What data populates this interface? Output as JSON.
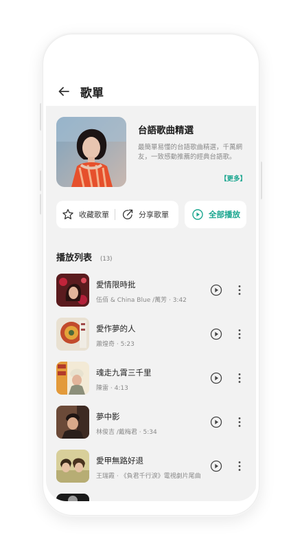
{
  "header": {
    "title": "歌單"
  },
  "playlist": {
    "title": "台語歌曲精選",
    "description": "最簡單易懂的台語歌曲精選，千萬網友，一致感動推薦的經典台語歌。",
    "more_label": "【更多】"
  },
  "actions": {
    "favorite_label": "收藏歌單",
    "share_label": "分享歌單",
    "play_all_label": "全部播放"
  },
  "list": {
    "title": "播放列表",
    "count": "(13)",
    "tracks": [
      {
        "name": "愛情限時批",
        "meta": "伍佰 & China Blue /萬芳 · 3:42"
      },
      {
        "name": "愛作夢的人",
        "meta": "蕭煌奇 · 5:23"
      },
      {
        "name": "魂走九霄三千里",
        "meta": "陳雷 · 4:13"
      },
      {
        "name": "夢中影",
        "meta": "林俊吉 /戴梅君 · 5:34"
      },
      {
        "name": "愛甲無路好退",
        "meta": "王瑞霞 · 《負君千行淚》電視劇片尾曲"
      }
    ]
  },
  "colors": {
    "accent": "#1aa68f",
    "background": "#f2f2f2",
    "card": "#ffffff"
  },
  "icons": {
    "back": "arrow-left-icon",
    "favorite": "star-icon",
    "share": "share-icon",
    "play_all": "play-circle-icon",
    "track_play": "play-circle-icon",
    "track_more": "more-vertical-icon"
  }
}
